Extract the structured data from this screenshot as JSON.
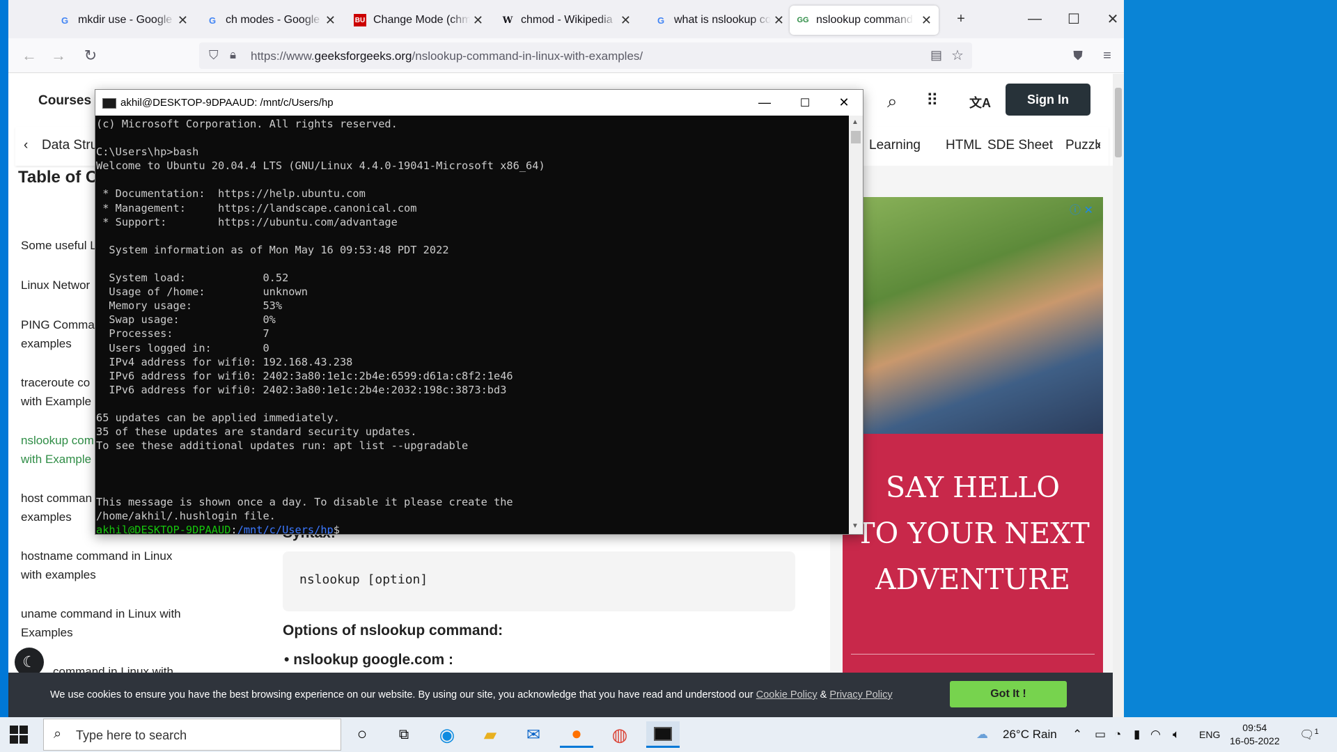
{
  "browser": {
    "tabs": [
      {
        "title": "mkdir use - Google Se",
        "favicon": "google-icon"
      },
      {
        "title": "ch modes - Google Se",
        "favicon": "google-icon"
      },
      {
        "title": "Change Mode (chmo",
        "favicon": "bu-icon"
      },
      {
        "title": "chmod - Wikipedia",
        "favicon": "wikipedia-icon"
      },
      {
        "title": "what is nslookup com",
        "favicon": "google-icon"
      },
      {
        "title": "nslookup command i",
        "favicon": "gfg-icon"
      }
    ],
    "url_prefix": "https://www.",
    "url_domain": "geeksforgeeks.org",
    "url_path": "/nslookup-command-in-linux-with-examples/"
  },
  "page": {
    "courses_label": "Courses",
    "signin_label": "Sign In",
    "subnav_prev": "Data Struc",
    "subnav_items": [
      "Learning",
      "HTML",
      "SDE Sheet",
      "Puzzle"
    ],
    "toc_title": "Table of C",
    "toc_items": [
      "Some useful L",
      "Linux Networ",
      "PING Comma examples",
      "traceroute co with Example",
      "nslookup com with Example",
      "host comman examples",
      "hostname command in Linux with examples",
      "uname command in Linux with Examples",
      "command in Linux with"
    ],
    "syntax_label": "Syntax:",
    "code": "nslookup [option]",
    "options_heading": "Options of nslookup command:",
    "bullet": "nslookup google.com :",
    "ad_text": [
      "SAY HELLO",
      "TO YOUR NEXT",
      "ADVENTURE"
    ],
    "cookie_msg": "We use cookies to ensure you have the best browsing experience on our website. By using our site, you acknowledge that you have read and understood our ",
    "cookie_link1": "Cookie Policy",
    "cookie_amp": " & ",
    "cookie_link2": "Privacy Policy",
    "gotit_label": "Got It !"
  },
  "terminal": {
    "title": "akhil@DESKTOP-9DPAAUD: /mnt/c/Users/hp",
    "lines": [
      "(c) Microsoft Corporation. All rights reserved.",
      "",
      "C:\\Users\\hp>bash",
      "Welcome to Ubuntu 20.04.4 LTS (GNU/Linux 4.4.0-19041-Microsoft x86_64)",
      "",
      " * Documentation:  https://help.ubuntu.com",
      " * Management:     https://landscape.canonical.com",
      " * Support:        https://ubuntu.com/advantage",
      "",
      "  System information as of Mon May 16 09:53:48 PDT 2022",
      "",
      "  System load:            0.52",
      "  Usage of /home:         unknown",
      "  Memory usage:           53%",
      "  Swap usage:             0%",
      "  Processes:              7",
      "  Users logged in:        0",
      "  IPv4 address for wifi0: 192.168.43.238",
      "  IPv6 address for wifi0: 2402:3a80:1e1c:2b4e:6599:d61a:c8f2:1e46",
      "  IPv6 address for wifi0: 2402:3a80:1e1c:2b4e:2032:198c:3873:bd3",
      "",
      "65 updates can be applied immediately.",
      "35 of these updates are standard security updates.",
      "To see these additional updates run: apt list --upgradable",
      "",
      "",
      "",
      "This message is shown once a day. To disable it please create the",
      "/home/akhil/.hushlogin file."
    ],
    "prompt_user": "akhil@DESKTOP-9DPAAUD",
    "prompt_sep": ":",
    "prompt_path": "/mnt/c/Users/hp",
    "prompt_end": "$"
  },
  "taskbar": {
    "search_placeholder": "Type here to search",
    "weather": "26°C  Rain",
    "language": "ENG",
    "time": "09:54",
    "date": "16-05-2022",
    "notification_count": "1"
  }
}
